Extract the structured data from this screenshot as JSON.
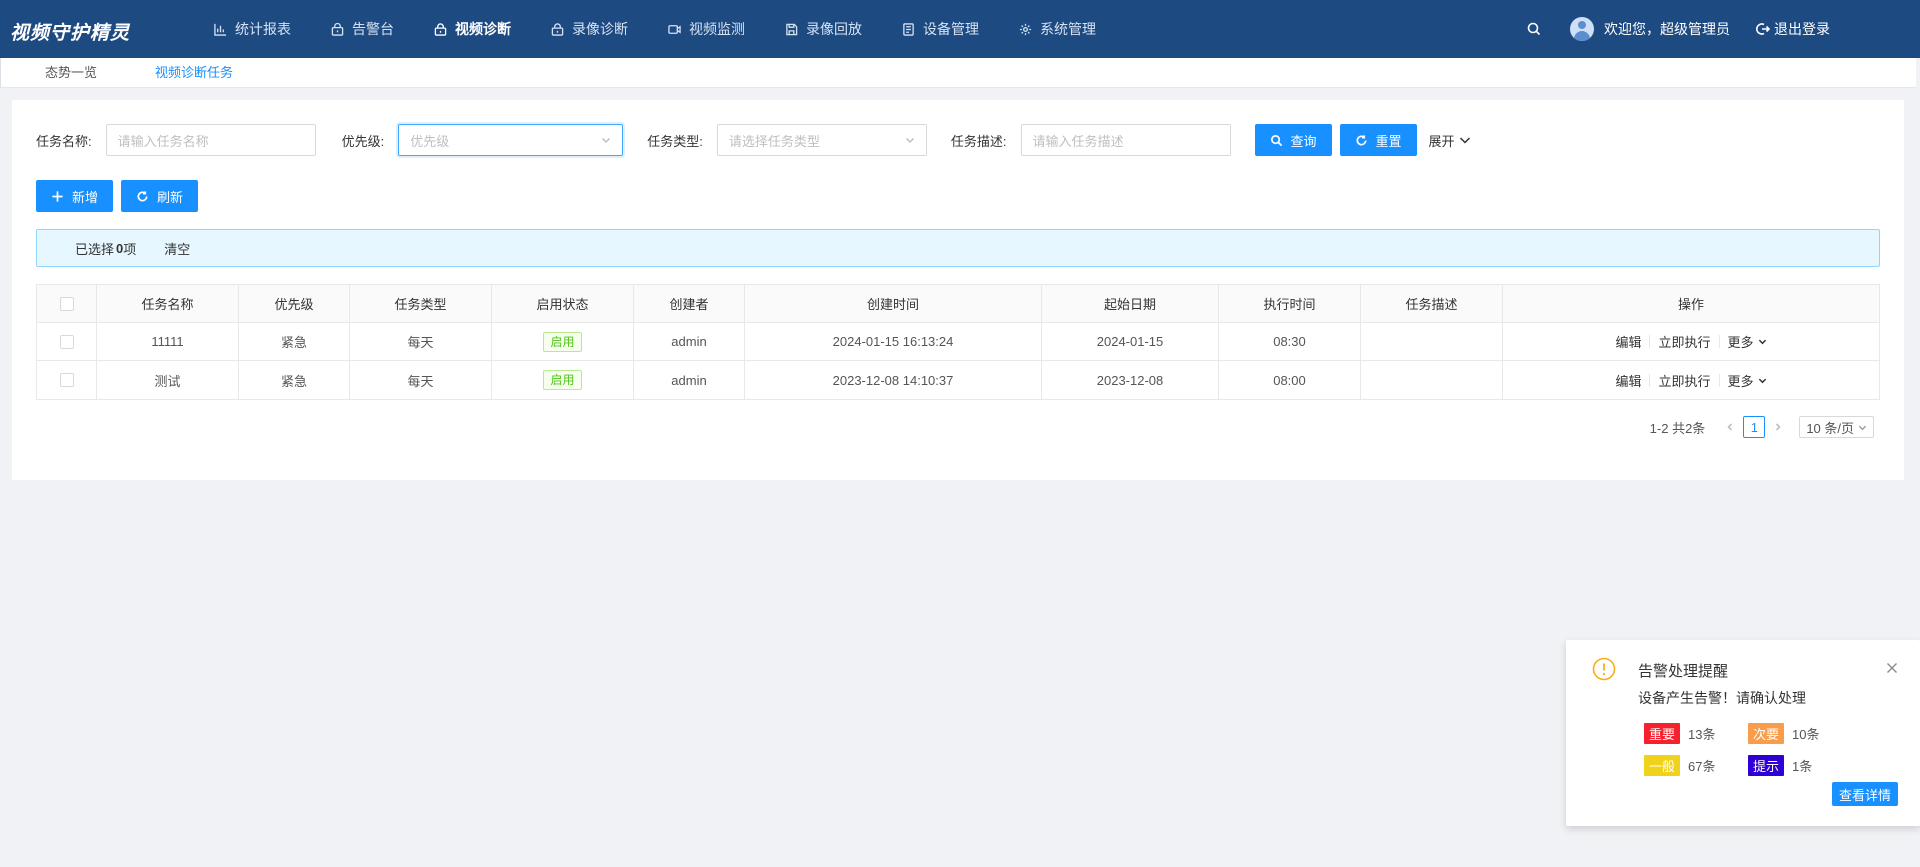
{
  "header": {
    "brand": "视频守护精灵",
    "nav": [
      {
        "label": "统计报表",
        "icon": "bar-chart-icon",
        "active": false
      },
      {
        "label": "告警台",
        "icon": "alarm-icon",
        "active": false
      },
      {
        "label": "视频诊断",
        "icon": "lock-icon",
        "active": true
      },
      {
        "label": "录像诊断",
        "icon": "lock-icon",
        "active": false
      },
      {
        "label": "视频监测",
        "icon": "video-camera-icon",
        "active": false
      },
      {
        "label": "录像回放",
        "icon": "save-icon",
        "active": false
      },
      {
        "label": "设备管理",
        "icon": "document-icon",
        "active": false
      },
      {
        "label": "系统管理",
        "icon": "gear-icon",
        "active": false
      }
    ],
    "welcome": "欢迎您，超级管理员",
    "logout": "退出登录"
  },
  "tabs": [
    "态势一览",
    "视频诊断任务"
  ],
  "filters": {
    "name_label": "任务名称:",
    "name_placeholder": "请输入任务名称",
    "priority_label": "优先级:",
    "priority_placeholder": "优先级",
    "type_label": "任务类型:",
    "type_placeholder": "请选择任务类型",
    "desc_label": "任务描述:",
    "desc_placeholder": "请输入任务描述",
    "query": "查询",
    "reset": "重置",
    "expand": "展开"
  },
  "actions": {
    "add": "新增",
    "refresh": "刷新"
  },
  "selection": {
    "prefix": "已选择",
    "count": "0",
    "suffix": "项",
    "clear": "清空"
  },
  "table": {
    "columns": [
      "任务名称",
      "优先级",
      "任务类型",
      "启用状态",
      "创建者",
      "创建时间",
      "起始日期",
      "执行时间",
      "任务描述",
      "操作"
    ],
    "rows": [
      {
        "name": "11111",
        "priority": "紧急",
        "type": "每天",
        "status": "启用",
        "creator": "admin",
        "created": "2024-01-15 16:13:24",
        "start": "2024-01-15",
        "exec": "08:30",
        "desc": ""
      },
      {
        "name": "测试",
        "priority": "紧急",
        "type": "每天",
        "status": "启用",
        "creator": "admin",
        "created": "2023-12-08 14:10:37",
        "start": "2023-12-08",
        "exec": "08:00",
        "desc": ""
      }
    ],
    "op_edit": "编辑",
    "op_run": "立即执行",
    "op_more": "更多"
  },
  "pagination": {
    "total": "1-2 共2条",
    "current": "1",
    "size": "10 条/页"
  },
  "notification": {
    "title": "告警处理提醒",
    "desc": "设备产生告警！请确认处理",
    "items": [
      {
        "label": "重要",
        "count": "13条",
        "color": "#f5222d"
      },
      {
        "label": "次要",
        "count": "10条",
        "color": "#fa9d4b"
      },
      {
        "label": "一般",
        "count": "67条",
        "color": "#f0d21b"
      },
      {
        "label": "提示",
        "count": "1条",
        "color": "#2f00d6"
      }
    ],
    "detail": "查看详情"
  }
}
